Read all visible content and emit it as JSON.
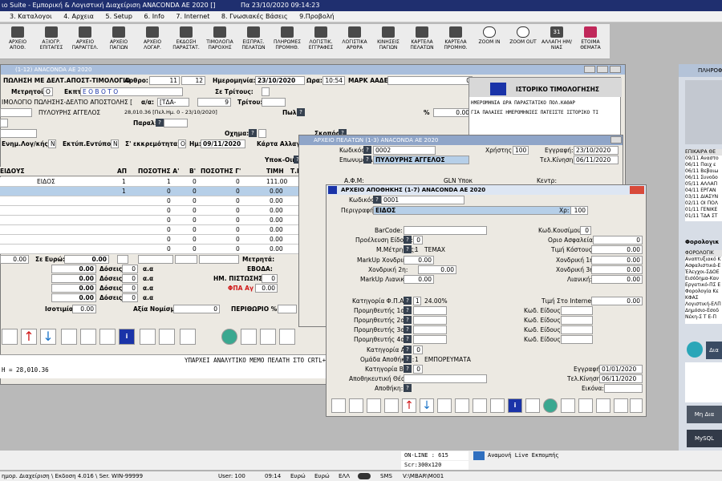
{
  "window_title": "ιο Suite - Εμπορική  &  Λογιστική Διαχείριση ANACONDA AE 2020 []",
  "window_datetime": "Πα  23/10/2020  09:14:23",
  "menu": [
    "3. Καταλογοι",
    "4. Αρχεια",
    "5. Setup",
    "6. Info",
    "7. Internet",
    "8. Γνωσιακές Βάσεις",
    "9.Προβολή"
  ],
  "toolbar": [
    "ΑΡΧΕΙΟ ΑΠΟΘ.",
    "ΑΞΙΟΓΡ. ΕΠΙΤΑΓΕΣ",
    "ΑΡΧΕΙΟ ΠΑΡΑΓΓΕΛ.",
    "ΑΡΧΕΙΟ ΠΑΓΙΩΝ",
    "ΑΡΧΕΙΟ ΛΟΓΑΡ.",
    "ΕΚΔΟΣΗ ΠΑΡΑΣΤΑΤ.",
    "ΤΙΜΟΛΟΓΙΑ ΠΑΡΟΧΗΣ",
    "ΕΙΣΠΡΑΞ. ΠΕΛΑΤΩΝ",
    "ΠΛΗΡΩΜΕΣ ΠΡΟΜΗΘ.",
    "ΛΟΓΙΣΤΙΚ. ΕΓΓΡΑΦΕΣ",
    "ΛΟΓΙΣΤΙΚΑ ΑΡΘΡΑ",
    "ΚΙΝΗΣΕΙΣ ΠΑΓΙΩΝ",
    "ΚΑΡΤΕΛΑ ΠΕΛΑΤΩΝ",
    "ΚΑΡΤΕΛΑ ΠΡΟΜΗΘ.",
    "ZOOM IN",
    "ZOOM OUT",
    "ΑΛΛΑΓΗ ΗΜ/ΝΙΑΣ",
    "ΕΤΟΙΜΑ ΘΕΜΑΤΑ"
  ],
  "calendar_day": "31",
  "invoice": {
    "header": "(1-12)          ANACONDA AE 2020",
    "doc_type": "ΠΩΛΗΣΗ ΜΕ ΔΕΛΤ.ΑΠΟΣΤ-ΤΙΜΟΛΟΓΙΟ",
    "arthro_label": "Αρθρο:",
    "arthro_1": "11",
    "arthro_2": "12",
    "date_label": "Ημερομηνία:",
    "date": "23/10/2020",
    "time_label": "Ωρα:",
    "time": "10:54",
    "mark_label": "ΜΑΡΚ ΑΑΔΕ:",
    "mark": "0",
    "metritis_label": "Μετρητοίς:",
    "metritis": "Ο",
    "ekpt_label": "Εκπτ:",
    "ekpt": "Ε Ο  Β Ο  Τ Ο",
    "tritous_label": "Σε Τρίτους:",
    "doc_sub": "ΙΜΟΛΟΓΙΟ ΠΩΛΗΣΗΣ-ΔΕΛΤΙΟ ΑΠΟΣΤΟΛΗΣ [",
    "aa_label": "α/α:",
    "aa": "[ΤΔΑ-",
    "aa_num": "9",
    "tritou_label": "Τρίτου:",
    "customer_name": "ΠΥΛΟΥΡΗΣ ΑΓΓΕΛΟΣ",
    "balance_note": "28,010.36 [Πελ.Ημ.   0 - 23/10/2020]",
    "pol_label": "Πωλ:",
    "percent_label": "%",
    "percent": "0.00",
    "paral_label": "Παραλ:",
    "oxima_label": "Οχημα:",
    "skopos_label": "Σκοπός:",
    "enim_label": "Ενημ.Λογ/κής:",
    "enim": "N",
    "ektyp_label": "Εκτύπ.Εντύπου:",
    "ektyp": "N",
    "ekkrem_label": "Σ' εκκρεμότητα:",
    "ekkrem": "Ο",
    "im_label": "Ημ:",
    "im": "09/11/2020",
    "karta_label": "Κάρτα Αλλαγ",
    "ypok_label": "Υποκ-Οικοδ",
    "grid_headers": [
      "ΕΙΔΟΥΣ",
      "ΑΠ",
      "ΠΟΣΟΤΗΣ Α'",
      "Β'",
      "ΠΟΣΟΤΗΣ Γ'",
      "ΤΙΜΗ",
      "Τ.Ε"
    ],
    "grid_rows": [
      {
        "item": "ΕΙΔΟΣ",
        "ap": "1",
        "qa": "1",
        "qb": "0",
        "qg": "0",
        "price": "111.00"
      },
      {
        "item": "",
        "ap": "1",
        "qa": "0",
        "qb": "0",
        "qg": "0",
        "price": "0.00"
      },
      {
        "item": "",
        "ap": "",
        "qa": "0",
        "qb": "0",
        "qg": "0",
        "price": "0.00"
      },
      {
        "item": "",
        "ap": "",
        "qa": "0",
        "qb": "0",
        "qg": "0",
        "price": "0.00"
      },
      {
        "item": "",
        "ap": "",
        "qa": "0",
        "qb": "0",
        "qg": "0",
        "price": "0.00"
      },
      {
        "item": "",
        "ap": "",
        "qa": "0",
        "qb": "0",
        "qg": "0",
        "price": "0.00"
      },
      {
        "item": "",
        "ap": "",
        "qa": "0",
        "qb": "0",
        "qg": "0",
        "price": "0.00"
      },
      {
        "item": "",
        "ap": "",
        "qa": "0",
        "qb": "0",
        "qg": "0",
        "price": "0.00"
      }
    ],
    "total_left": "0.00",
    "se_evro_label": "Σε Ευρώ:",
    "se_evro": "0.00",
    "metrita_label": "Μετρητά:",
    "doseis": [
      {
        "amount": "0.00",
        "label": "Δόσεις",
        "n": "0",
        "aa": "α.α"
      },
      {
        "amount": "0.00",
        "label": "Δόσεις",
        "n": "0",
        "aa": "α.α"
      },
      {
        "amount": "0.00",
        "label": "Δόσεις",
        "n": "0",
        "aa": "α.α"
      },
      {
        "amount": "0.00",
        "label": "Δόσεις",
        "n": "0",
        "aa": "α.α"
      }
    ],
    "evoda_label": "ΕΒΟΔΑ:",
    "im_pistosis_label": "ΗΜ. ΠΙΣΤΩΣΗΣ:",
    "im_pistosis": "0",
    "fpa_label": "ΦΠΑ Αγ",
    "fpa": "0.00",
    "isotimia_label": "Ισοτιμία",
    "isotimia": "0.00",
    "axia_label": "Αξία Νομίσμ:",
    "axia": "0",
    "periorio_label": "ΠΕΡΙΘΩΡΙΟ %:",
    "memo": "ΥΠΑΡΧΕΙ ΑΝΑΛΥΤΙΚΟ ΜΕΜΟ ΠΕΛΑΤΗ ΣΤΟ CRTL+1",
    "total_line": "Η =       28,010.36"
  },
  "history": {
    "title": "ΙΣΤΟΡΙΚΟ ΤΙΜΟΛΟΓΗΣΗΣ",
    "headers": "ΗΜΕΡΟΜΗΝΙΑ ΩΡΑ     ΠΑΡΑΣΤΑΤΙΚΟ       ΠΟΛ.ΚΑΘΑΡ",
    "note": "ΓΙΑ ΠΑΛΑΙΕΣ ΗΜΕΡΟΜΗΝΙΕΣ ΠΑΤΕΙΣΤΕ ΙΣΤΟΡΙΚΟ ΤΙ"
  },
  "customer_file": {
    "header": "ΑΡΧΕΙΟ ΠΕΛΑΤΩΝ          (1-3)          ANACONDA AE 2020",
    "code_label": "Κωδικός:",
    "code": "0002",
    "user_label": "Χρήστης:",
    "user": "100",
    "reg_label": "Εγγραφή:",
    "reg": "23/10/2020",
    "name_label": "Επωνυμο(Δ):",
    "name": "ΠΥΛΟΥΡΗΣ ΑΓΓΕΛΟΣ",
    "last_label": "Τελ.Κίνηση:",
    "last": "06/11/2020",
    "afm_label": "Α.Φ.Μ:",
    "gln_label": "GLN Υποκ",
    "kentr_label": "Κεντρ:"
  },
  "warehouse": {
    "header": "ΑΡΧΕΙΟ ΑΠΟΘΗΚΗΣ        (1-7)                ANACONDA AE 2020",
    "code_label": "Κωδικός:",
    "code": "0001",
    "desc_label": "Περιγραφή:",
    "desc": "ΕΙΔΟΣ",
    "xr_label": "Χρ:",
    "xr": "100",
    "left": [
      {
        "label": "BarCode:",
        "value": ""
      },
      {
        "label": "Προέλευση Είδους:",
        "value": "0"
      },
      {
        "label": "Μ.Μέτρησης:",
        "value": "1",
        "extra": "TEMAX"
      },
      {
        "label": "MarkUp Χονδρικής:",
        "value": "0.00"
      },
      {
        "label": "Χονδρική 2η:",
        "value": "0.00"
      },
      {
        "label": "MarkUp Λιανικής:",
        "value": "0.00"
      }
    ],
    "right": [
      {
        "label": "Κωδ.Κουσίμου:",
        "value": "0"
      },
      {
        "label": "Οριο Ασφαλείας:",
        "value": "0"
      },
      {
        "label": "Τιμή Κόστους:",
        "value": "0.00"
      },
      {
        "label": "Χονδρική 1η:",
        "value": "0.00"
      },
      {
        "label": "Χονδρική 3η:",
        "value": "0.00"
      },
      {
        "label": "Λιανική:",
        "value": "0.00"
      }
    ],
    "fpa_label": "Κατηγορία Φ.Π.Α.:",
    "fpa": "1",
    "fpa_rate": "24.00%",
    "internet_label": "Τιμή Στο Internet:",
    "internet": "0.00",
    "suppliers": [
      "Προμηθευτής 1ος:",
      "Προμηθευτής 2ος:",
      "Προμηθευτής 3ος:",
      "Προμηθευτής 4ος:"
    ],
    "kod_eidous": [
      "Κωδ. Είδους:",
      "Κωδ. Είδους:",
      "Κωδ. Είδους:",
      "Κωδ. Είδους:"
    ],
    "katA_label": "Κατηγορία Α':",
    "katA": "0",
    "omada_label": "Ομάδα Αποθήκης:",
    "omada": "1",
    "omada_name": "ΕΜΠΟΡΕΥΜΑΤΑ",
    "katB_label": "Κατηγορία Β':",
    "katB": "0",
    "reg_label": "Εγγραφή:",
    "reg": "01/01/2020",
    "thesi_label": "Αποθηκευτική Θέση:",
    "last_label": "Τελ.Κίνηση:",
    "last": "06/11/2020",
    "apothiki_label": "Αποθήκη:",
    "eikona_label": "Εικόνα:"
  },
  "right_panel": {
    "title": "ΠΛΗΡΟΦ",
    "epikaira": "ΕΠΙΚΑΙΡΑ ΘΕ",
    "news": [
      "09/11 Αναστο",
      "06/11 Παιχ ε",
      "06/11 Βεβαιω",
      "06/11 Συνοδο",
      "05/11 ΑΛΛΑΠ",
      "04/11 ΕΡΓΑΝ",
      "03/11 ΔΙΑΣΥΝ",
      "02/11 ΟΙ ΠΟΛ",
      "01/11 ΓΕΝΙΚΕ",
      "01/11 ΤΔΑ ΣΤ"
    ],
    "forologika": "Φορολογικ",
    "tax_header": "ΦΟΡΟΛΟΓΙΚ",
    "tax_items": [
      "Αναπτυξιακό Κ",
      "Ασφαλιστικά-Ε",
      "Έλεγχοι-ΣΔΟΕ",
      "Εισόδημα-Καν",
      "Εργατικό-ΠΣ Ε",
      "Φορολογία Κε",
      "ΚΦΑΣ",
      "Λογιστική-ΕΛΠ",
      "Δημόσιο-Εσοδ",
      "Νέκη-Σ Τ Ε-Π"
    ],
    "btn1": "Δια",
    "btn2": "Μη Δια",
    "btn3": "MySQL"
  },
  "status": {
    "online": "ON-LINE : 615",
    "anamoni": "Αναμονή Live Εκπομπής",
    "scr": "Scr:300x120",
    "path": "ημορ. Διαχείριση \\ Εκδοση 4.016 \\ Ser. WIN-99999",
    "user": "User: 100",
    "time": "09:14",
    "evro1": "Ευρώ",
    "evro2": "Ευρώ",
    "ell": "ΕΛΛ",
    "sms": "SMS",
    "drive": "V:\\MBAR\\M001"
  }
}
